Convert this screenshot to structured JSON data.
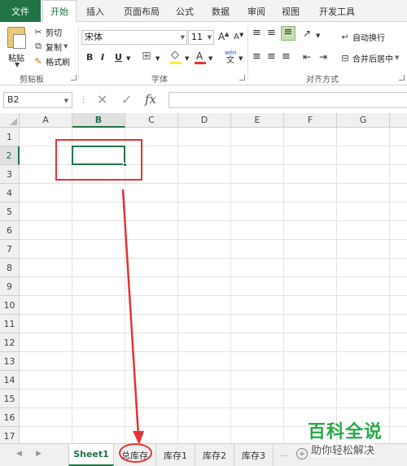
{
  "menu": {
    "file": "文件",
    "tabs": [
      "开始",
      "插入",
      "页面布局",
      "公式",
      "数据",
      "审阅",
      "视图",
      "开发工具"
    ]
  },
  "ribbon": {
    "clipboard": {
      "paste": "粘贴",
      "cut": "剪切",
      "copy": "复制",
      "format_painter": "格式刷",
      "label": "剪贴板"
    },
    "font": {
      "name": "宋体",
      "size": "11",
      "label": "字体",
      "bold": "B",
      "italic": "I",
      "underline": "U",
      "grow": "A",
      "shrink": "A",
      "font_color": "A",
      "wen": "wén",
      "wen_char": "文"
    },
    "alignment": {
      "wrap_text": "自动换行",
      "merge_center": "合并后居中",
      "label": "对齐方式"
    }
  },
  "formula_bar": {
    "name_box": "B2",
    "fx": "fx",
    "separator": "⋮",
    "cancel": "✕",
    "enter": "✓",
    "value": ""
  },
  "grid": {
    "columns": [
      "A",
      "B",
      "C",
      "D",
      "E",
      "F",
      "G"
    ],
    "rows": [
      "1",
      "2",
      "3",
      "4",
      "5",
      "6",
      "7",
      "8",
      "9",
      "10",
      "11",
      "12",
      "13",
      "14",
      "15",
      "16",
      "17"
    ],
    "selected_cell": "B2"
  },
  "sheets": {
    "tabs": [
      "Sheet1",
      "总库存",
      "库存1",
      "库存2",
      "库存3"
    ],
    "active": "Sheet1",
    "more": "..."
  },
  "watermark": {
    "title": "百科全说",
    "subtitle": "助你轻松解决"
  },
  "colors": {
    "accent": "#217346",
    "annotation": "#e53333",
    "watermark": "#2aaa4a"
  }
}
